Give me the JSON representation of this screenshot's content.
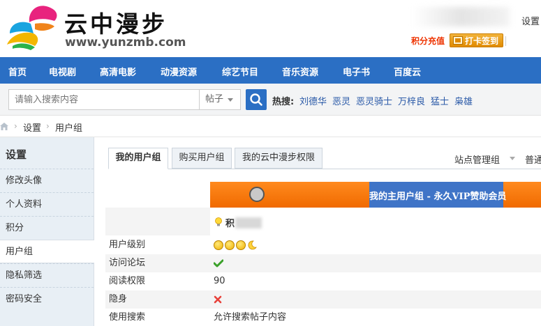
{
  "header": {
    "site_title": "云中漫步",
    "site_url": "www.yunzmb.com",
    "settings_link": "设置",
    "points_topup": "积分充值",
    "checkin_button": "打卡签到"
  },
  "nav": {
    "items": [
      "首页",
      "电视剧",
      "高清电影",
      "动漫资源",
      "综艺节目",
      "音乐资源",
      "电子书",
      "百度云"
    ]
  },
  "search": {
    "placeholder": "请输入搜索内容",
    "scope": "帖子",
    "hot_label": "热搜:",
    "hot_items": [
      "刘德华",
      "恶灵",
      "恶灵骑士",
      "万梓良",
      "猛士",
      "枭雄"
    ]
  },
  "breadcrumb": {
    "items": [
      "设置",
      "用户组"
    ]
  },
  "sidebar": {
    "title": "设置",
    "items": [
      {
        "label": "修改头像"
      },
      {
        "label": "个人资料"
      },
      {
        "label": "积分"
      },
      {
        "label": "用户组",
        "active": true
      },
      {
        "label": "隐私筛选"
      },
      {
        "label": "密码安全"
      }
    ]
  },
  "tabs": {
    "items": [
      "我的用户组",
      "购买用户组",
      "我的云中漫步权限"
    ],
    "active_index": 0,
    "admin_group": "站点管理组",
    "normal_group": "普通"
  },
  "group": {
    "banner_text": "我的主用户组 - 永久VIP赞助会员",
    "points_label": "积"
  },
  "permissions": [
    {
      "label": "用户级别",
      "value": "",
      "icon": "level-stars"
    },
    {
      "label": "访问论坛",
      "value": "",
      "icon": "check-icon"
    },
    {
      "label": "阅读权限",
      "value": "90"
    },
    {
      "label": "隐身",
      "value": "",
      "icon": "cross-icon"
    },
    {
      "label": "使用搜索",
      "value": "允许搜索帖子内容"
    }
  ],
  "colors": {
    "nav_blue": "#2b6fc4",
    "banner_orange": "#f47c12",
    "banner_blue": "#3f74c7",
    "topup_red": "#ee3300"
  }
}
